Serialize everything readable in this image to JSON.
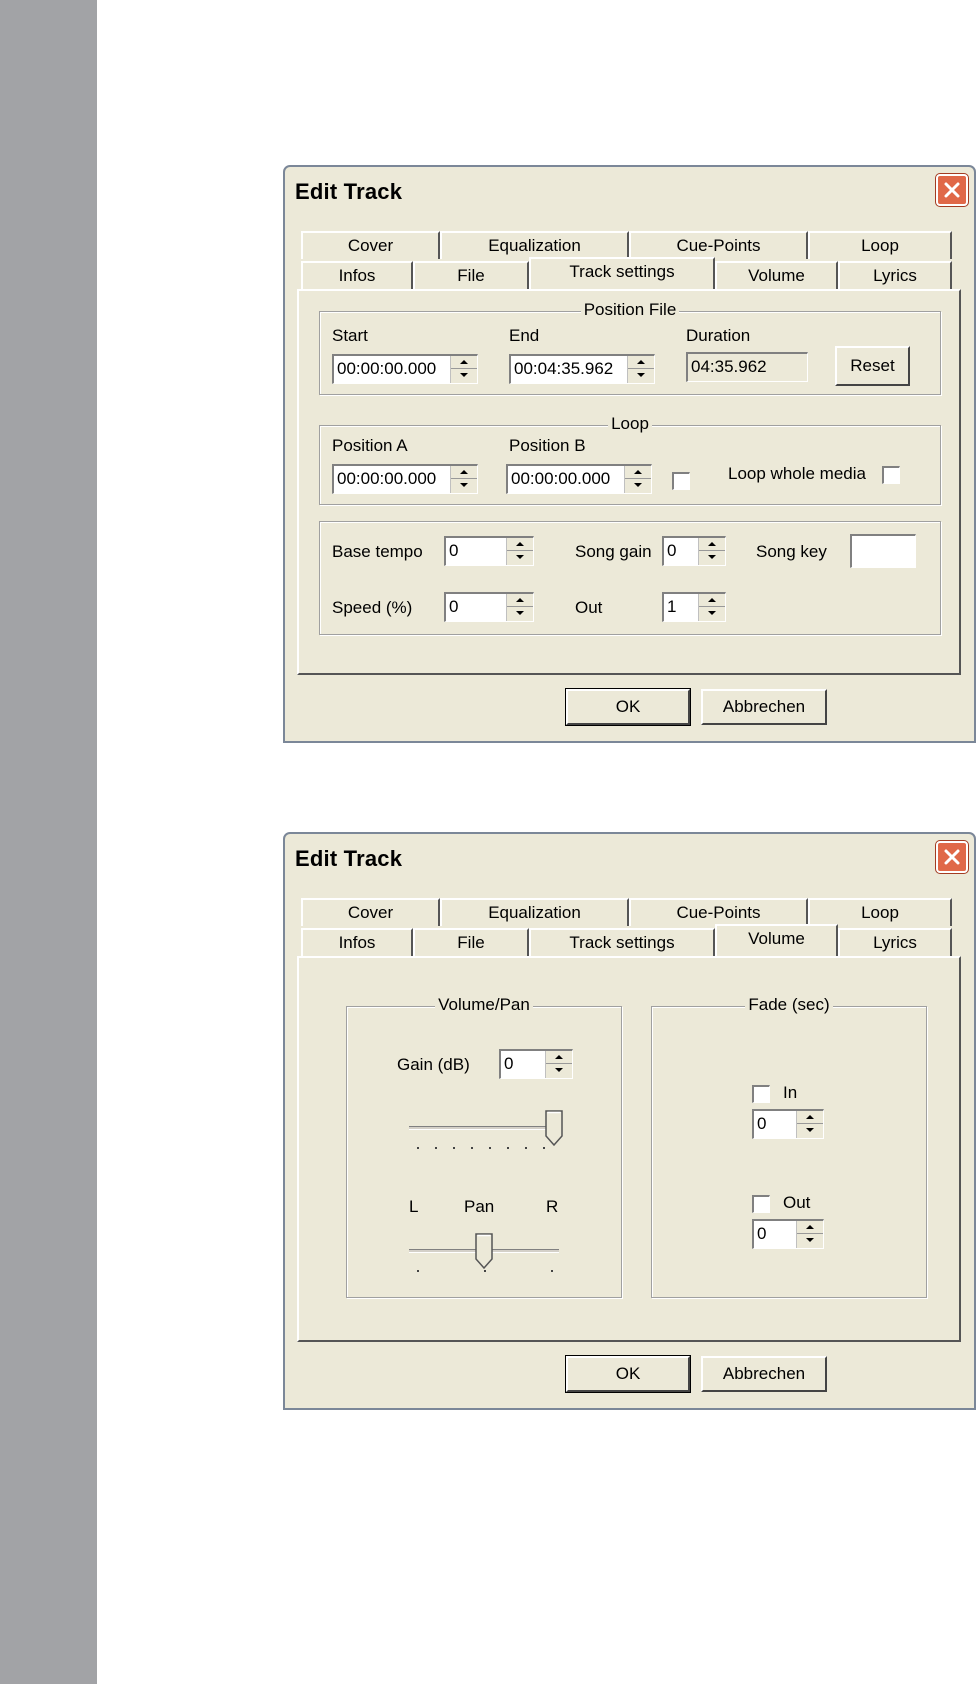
{
  "dialogs": [
    {
      "title": "Edit Track",
      "tabs_row1": [
        "Cover",
        "Equalization",
        "Cue-Points",
        "Loop"
      ],
      "tabs_row2": [
        "Infos",
        "File",
        "Track settings",
        "Volume",
        "Lyrics"
      ],
      "active_tab": "Track settings",
      "position_file": {
        "title": "Position File",
        "start_label": "Start",
        "start_value": "00:00:00.000",
        "end_label": "End",
        "end_value": "00:04:35.962",
        "duration_label": "Duration",
        "duration_value": "04:35.962",
        "reset_label": "Reset"
      },
      "loop": {
        "title": "Loop",
        "pos_a_label": "Position A",
        "pos_a_value": "00:00:00.000",
        "pos_b_label": "Position B",
        "pos_b_value": "00:00:00.000",
        "loop_whole_label": "Loop whole media"
      },
      "settings": {
        "base_tempo_label": "Base tempo",
        "base_tempo_value": "0",
        "song_gain_label": "Song gain",
        "song_gain_value": "0",
        "song_key_label": "Song key",
        "song_key_value": "",
        "speed_label": "Speed (%)",
        "speed_value": "0",
        "out_label": "Out",
        "out_value": "1"
      },
      "ok_label": "OK",
      "cancel_label": "Abbrechen"
    },
    {
      "title": "Edit Track",
      "tabs_row1": [
        "Cover",
        "Equalization",
        "Cue-Points",
        "Loop"
      ],
      "tabs_row2": [
        "Infos",
        "File",
        "Track settings",
        "Volume",
        "Lyrics"
      ],
      "active_tab": "Volume",
      "volume_pan": {
        "title": "Volume/Pan",
        "gain_label": "Gain (dB)",
        "gain_value": "0",
        "pan_left": "L",
        "pan_label": "Pan",
        "pan_right": "R"
      },
      "fade": {
        "title": "Fade (sec)",
        "in_label": "In",
        "in_value": "0",
        "out_label": "Out",
        "out_value": "0"
      },
      "ok_label": "OK",
      "cancel_label": "Abbrechen"
    }
  ],
  "colors": {
    "dialog_bg": "#ece9d8",
    "close_button": "#e06848",
    "sidebar_strip": "#a2a3a6"
  }
}
